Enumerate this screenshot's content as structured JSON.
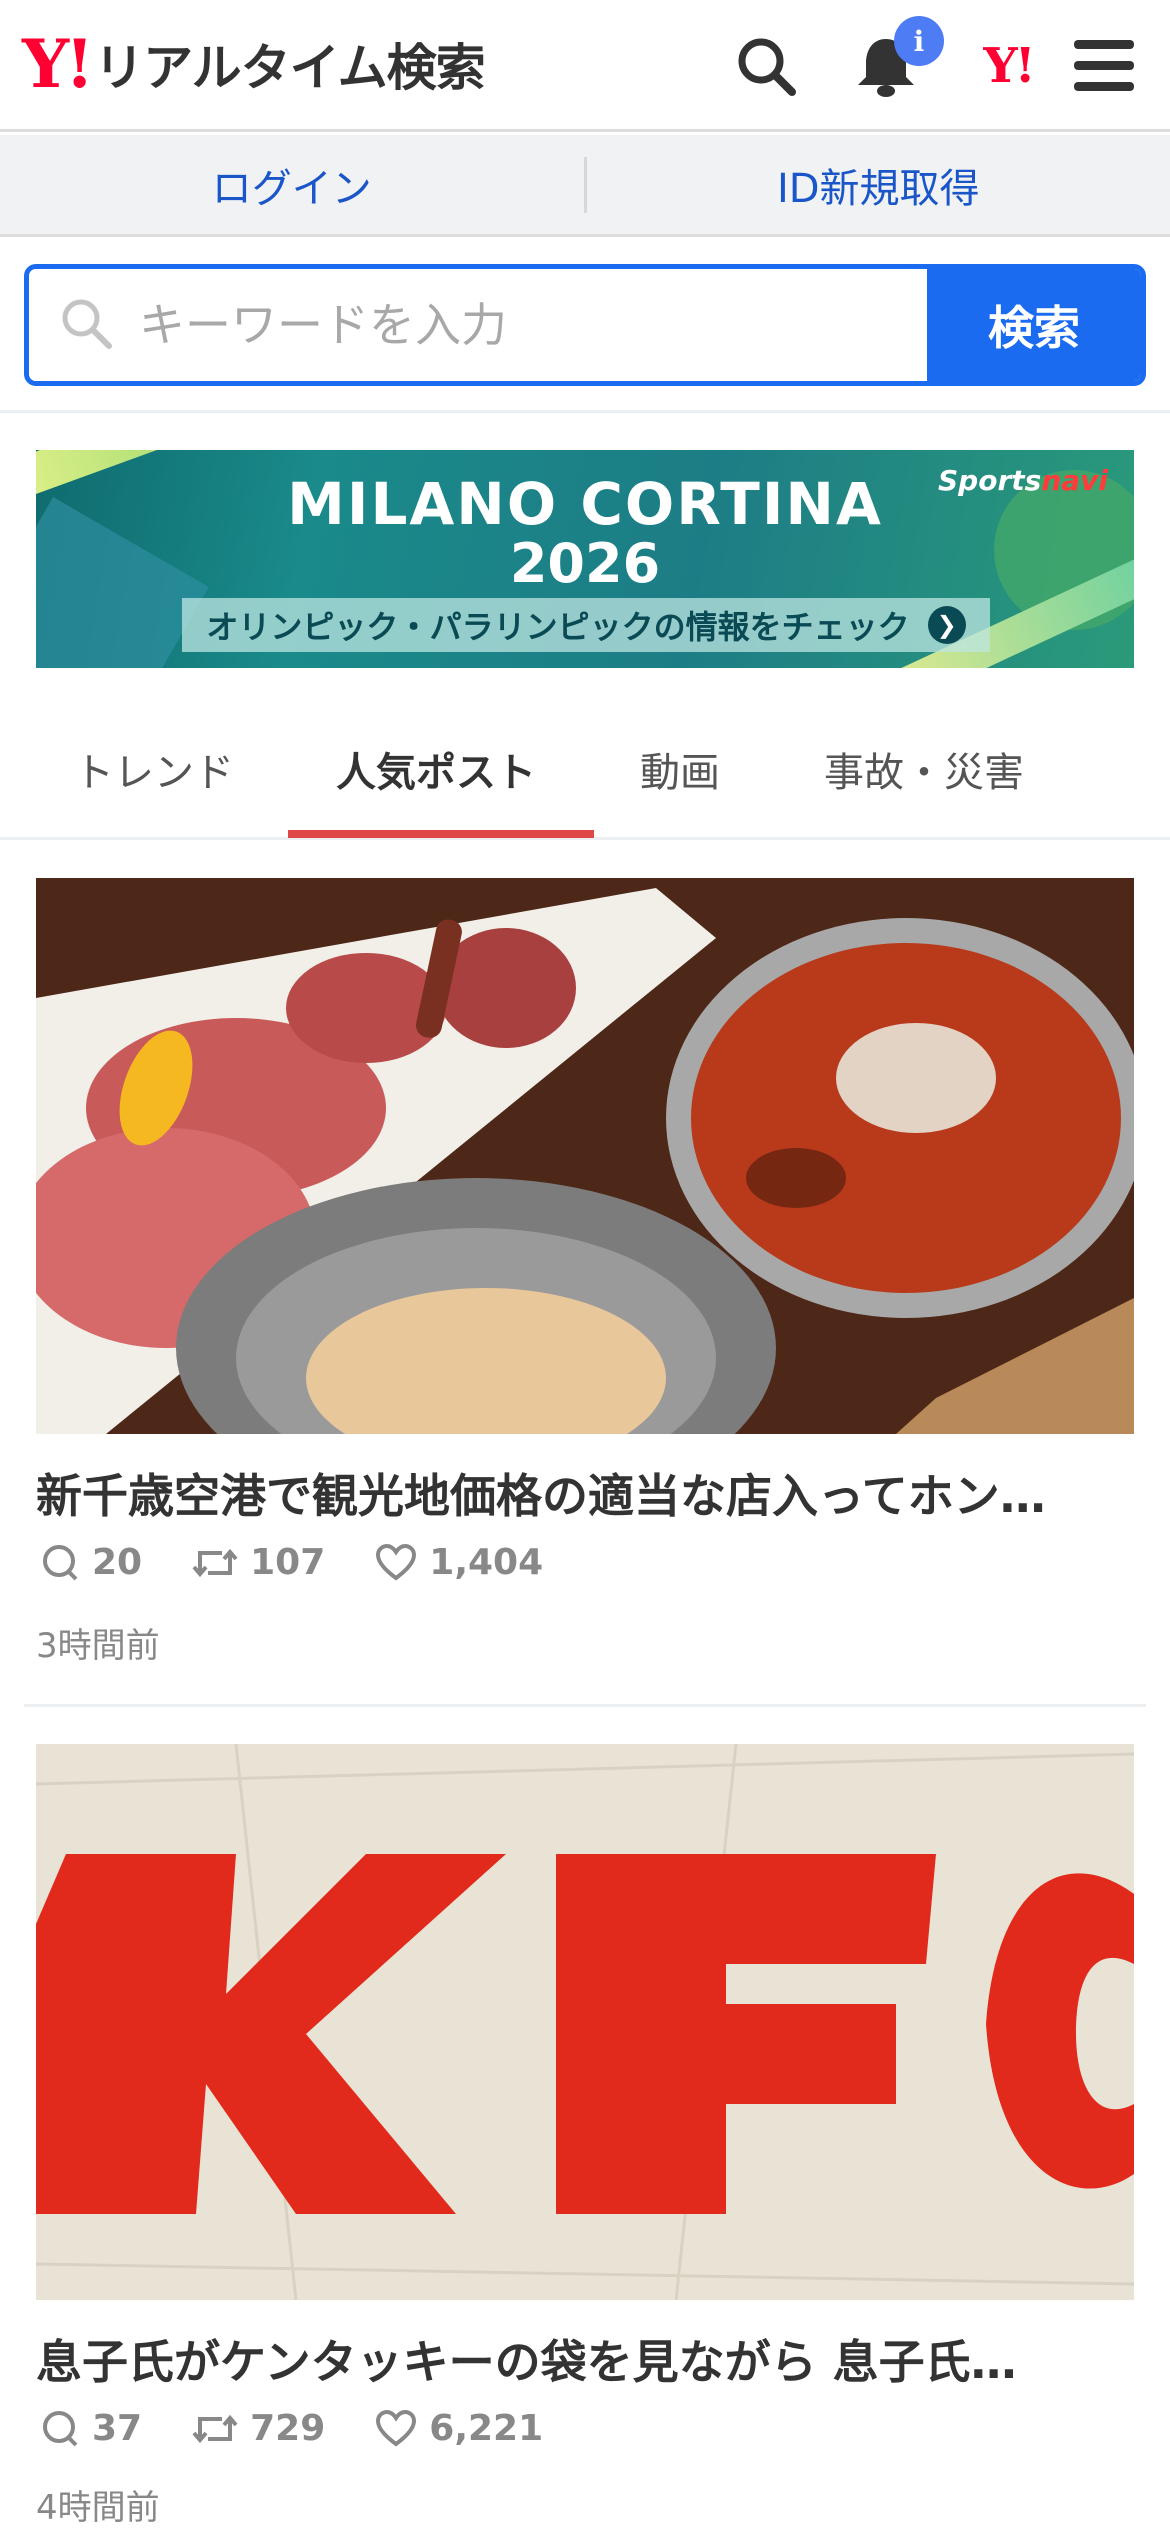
{
  "header": {
    "logo_mark": "Y!",
    "logo_text": "リアルタイム検索",
    "notification_badge": "i",
    "yahoo_mark": "Y!"
  },
  "account": {
    "login_label": "ログイン",
    "signup_label": "ID新規取得"
  },
  "search": {
    "placeholder": "キーワードを入力",
    "value": "",
    "button_label": "検索"
  },
  "banner": {
    "brand_a": "Sports",
    "brand_b": "navi",
    "title_line1": "MILANO CORTINA",
    "title_line2": "2026",
    "cta": "オリンピック・パラリンピックの情報をチェック"
  },
  "tabs": [
    {
      "label": "トレンド",
      "active": false
    },
    {
      "label": "人気ポスト",
      "active": true
    },
    {
      "label": "動画",
      "active": false
    },
    {
      "label": "事故・災害",
      "active": false
    }
  ],
  "posts": [
    {
      "title": "新千歳空港で観光地価格の適当な店入ってホン…",
      "replies": "20",
      "reposts": "107",
      "likes": "1,404",
      "time": "3時間前",
      "image": "yakiniku-and-spicy-ramen-photo"
    },
    {
      "title": "息子氏がケンタッキーの袋を見ながら 息子氏…",
      "replies": "37",
      "reposts": "729",
      "likes": "6,221",
      "time": "4時間前",
      "image": "kfc-paper-bag-photo"
    }
  ],
  "colors": {
    "brand_red": "#ff0033",
    "accent_blue": "#1a6bf0",
    "tab_underline": "#e04848"
  }
}
